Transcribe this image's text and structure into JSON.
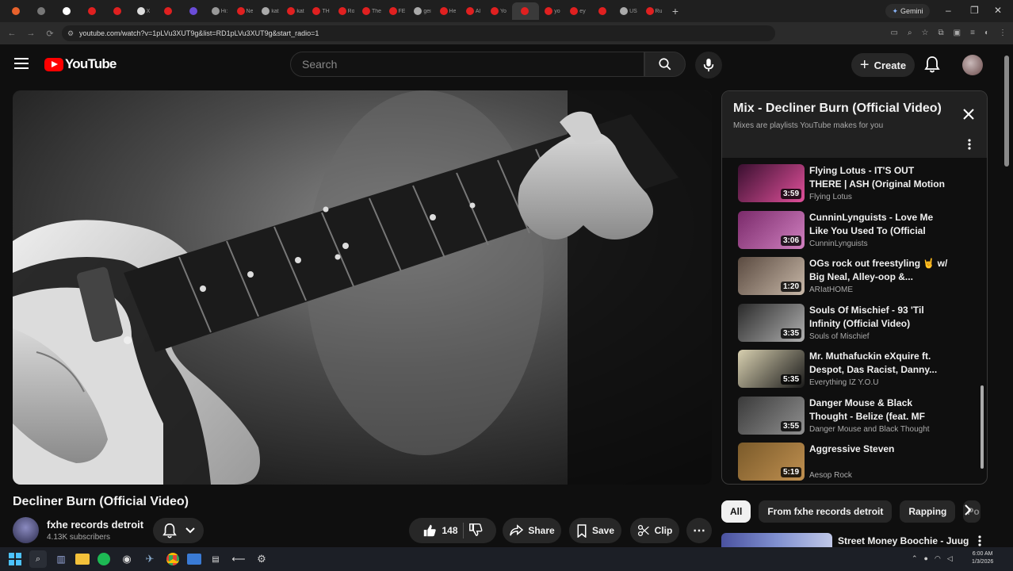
{
  "browser": {
    "tabs": [
      {
        "label": "",
        "color": "#e8622c"
      },
      {
        "label": "",
        "color": "#777777"
      },
      {
        "label": "",
        "color": "#ffffff"
      },
      {
        "label": "",
        "color": "#e02020"
      },
      {
        "label": "",
        "color": "#e02020"
      },
      {
        "label": "X",
        "color": "#dddddd"
      },
      {
        "label": "",
        "color": "#e02020"
      },
      {
        "label": "",
        "color": "#6a4cd8"
      },
      {
        "label": "Hi:",
        "color": "#999999"
      },
      {
        "label": "Ne",
        "color": "#e02020"
      },
      {
        "label": "kat",
        "color": "#aaaaaa"
      },
      {
        "label": "kat",
        "color": "#e02020"
      },
      {
        "label": "TH",
        "color": "#e02020"
      },
      {
        "label": "Ro",
        "color": "#e02020"
      },
      {
        "label": "The",
        "color": "#e02020"
      },
      {
        "label": "FE",
        "color": "#e02020"
      },
      {
        "label": "gei",
        "color": "#aaaaaa"
      },
      {
        "label": "He",
        "color": "#e02020"
      },
      {
        "label": "Al",
        "color": "#e02020"
      },
      {
        "label": "Yo",
        "color": "#e02020"
      },
      {
        "label": "",
        "color": "#e02020"
      },
      {
        "label": "yo",
        "color": "#e02020"
      },
      {
        "label": "ey",
        "color": "#e02020"
      },
      {
        "label": "",
        "color": "#e02020"
      },
      {
        "label": "US",
        "color": "#aaaaaa"
      },
      {
        "label": "Ru",
        "color": "#e02020"
      }
    ],
    "gemini_label": "Gemini",
    "url": "youtube.com/watch?v=1pLVu3XUT9g&list=RD1pLVu3XUT9g&start_radio=1"
  },
  "header": {
    "logo_text": "YouTube",
    "search_placeholder": "Search",
    "create_label": "Create"
  },
  "video": {
    "title": "Decliner Burn (Official Video)",
    "channel": "fxhe records detroit",
    "subscribers": "4.13K subscribers",
    "likes": "148",
    "share_label": "Share",
    "save_label": "Save",
    "clip_label": "Clip"
  },
  "playlist": {
    "title": "Mix - Decliner Burn (Official Video)",
    "subtitle": "Mixes are playlists YouTube makes for you",
    "items": [
      {
        "title": "Flying Lotus - IT'S OUT THERE | ASH (Original Motion Picture...",
        "channel": "Flying Lotus",
        "duration": "3:59",
        "c1": "#3a1030",
        "c2": "#e0509a"
      },
      {
        "title": "CunninLynguists - Love Me Like You Used To (Official Music...",
        "channel": "CunninLynguists",
        "duration": "3:06",
        "c1": "#7a2a6a",
        "c2": "#d080c0"
      },
      {
        "title": "OGs rock out freestyling 🤘 w/ Big Neal, Alley-oop &...",
        "channel": "ARIatHOME",
        "duration": "1:20",
        "c1": "#5a4a40",
        "c2": "#c8b8a8"
      },
      {
        "title": "Souls Of Mischief - 93 'Til Infinity (Official Video)",
        "channel": "Souls of Mischief",
        "duration": "3:35",
        "c1": "#2a2a2a",
        "c2": "#b0b0b0"
      },
      {
        "title": "Mr. Muthafuckin eXquire ft. Despot, Das Racist, Danny...",
        "channel": "Everything IZ Y.O.U",
        "duration": "5:35",
        "c1": "#d8d0b0",
        "c2": "#1a1a1a"
      },
      {
        "title": "Danger Mouse & Black Thought - Belize (feat. MF DOOM)...",
        "channel": "Danger Mouse and Black Thought",
        "duration": "3:55",
        "c1": "#3a3a3a",
        "c2": "#909090"
      },
      {
        "title": "Aggressive Steven",
        "channel": "Aesop Rock",
        "duration": "5:19",
        "c1": "#7a5a2a",
        "c2": "#c09050"
      }
    ]
  },
  "chips": [
    "All",
    "From fxhe records detroit",
    "Rapping",
    "Po"
  ],
  "next_video_title": "Street Money Boochie - Juug",
  "clock": {
    "time": "6:00 AM",
    "date": "1/3/2026"
  }
}
